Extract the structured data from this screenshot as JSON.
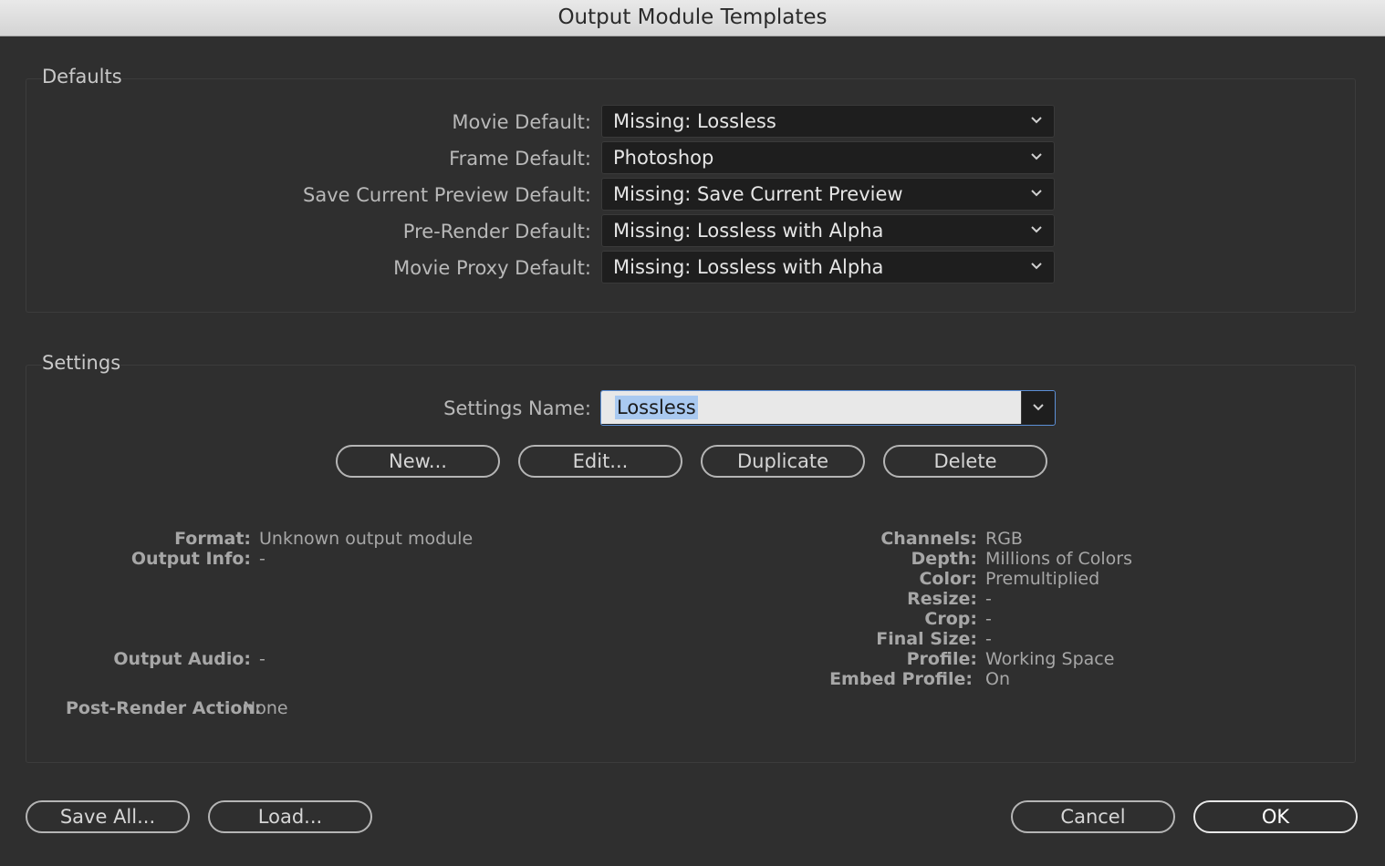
{
  "window": {
    "title": "Output Module Templates"
  },
  "defaults": {
    "title": "Defaults",
    "rows": [
      {
        "label": "Movie Default:",
        "value": "Missing: Lossless"
      },
      {
        "label": "Frame Default:",
        "value": "Photoshop"
      },
      {
        "label": "Save Current Preview Default:",
        "value": "Missing: Save Current Preview"
      },
      {
        "label": "Pre-Render Default:",
        "value": "Missing: Lossless with Alpha"
      },
      {
        "label": "Movie Proxy Default:",
        "value": "Missing: Lossless with Alpha"
      }
    ]
  },
  "settings": {
    "title": "Settings",
    "name_label": "Settings Name:",
    "name_value": "Lossless",
    "buttons": {
      "new": "New...",
      "edit": "Edit...",
      "duplicate": "Duplicate",
      "delete": "Delete"
    },
    "info_left": [
      {
        "label": "Format:",
        "value": "Unknown output module"
      },
      {
        "label": "Output Info:",
        "value": "-"
      },
      {
        "label": "Output Audio:",
        "value": "-"
      },
      {
        "label": "Post-Render Action:",
        "value": "None"
      }
    ],
    "info_right": [
      {
        "label": "Channels:",
        "value": "RGB"
      },
      {
        "label": "Depth:",
        "value": "Millions of Colors"
      },
      {
        "label": "Color:",
        "value": "Premultiplied"
      },
      {
        "label": "Resize:",
        "value": "-"
      },
      {
        "label": "Crop:",
        "value": "-"
      },
      {
        "label": "Final Size:",
        "value": "-"
      },
      {
        "label": "Profile:",
        "value": "Working Space"
      },
      {
        "label": "Embed Profile:",
        "value": "On"
      }
    ]
  },
  "footer": {
    "save_all": "Save All...",
    "load": "Load...",
    "cancel": "Cancel",
    "ok": "OK"
  },
  "colors": {
    "background": "#2f2f2f",
    "field": "#1e1e1e",
    "focus": "#5c8fd6",
    "selection": "#a9c9f0"
  },
  "icons": {
    "dropdown": "chevron-down-icon"
  }
}
